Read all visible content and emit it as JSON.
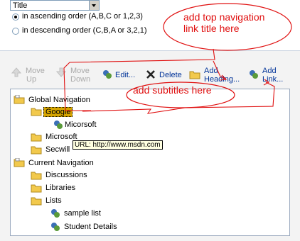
{
  "sort": {
    "selected": "Title",
    "ascending_label": "in ascending order (A,B,C or 1,2,3)",
    "descending_label": "in descending order (C,B,A or 3,2,1)"
  },
  "toolbar": {
    "move_up": [
      "Move",
      "Up"
    ],
    "move_down": [
      "Move",
      "Down"
    ],
    "edit": "Edit...",
    "delete": "Delete",
    "add_heading": [
      "Add",
      "Heading..."
    ],
    "add_link": [
      "Add",
      "Link..."
    ]
  },
  "tree": {
    "global": "Global Navigation",
    "google": "Google",
    "micorsoft": "Micorsoft",
    "microsoft": "Microsoft",
    "secwill": "Secwill",
    "current": "Current Navigation",
    "discussions": "Discussions",
    "libraries": "Libraries",
    "lists": "Lists",
    "sample_list": "sample list",
    "student_details": "Student Details"
  },
  "tooltip": "URL: http://www.msdn.com",
  "annotations": {
    "top": [
      "add top navigation",
      "link title here"
    ],
    "sub": "add subtitles here"
  },
  "colors": {
    "annotation": "#e01010",
    "link": "#003399",
    "selection": "#d6a500"
  }
}
